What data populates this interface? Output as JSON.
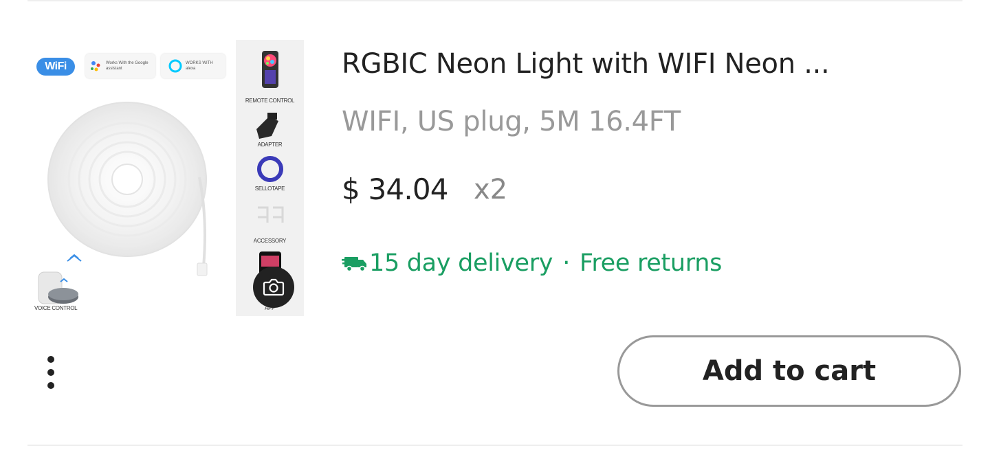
{
  "product": {
    "title": "RGBIC Neon Light with WIFI Neon ...",
    "variant": "WIFI, US plug, 5M 16.4FT",
    "price": "$ 34.04",
    "quantity": "x2",
    "delivery": "15 day delivery",
    "separator": "·",
    "returns": "Free returns",
    "accent_color": "#1a9e62"
  },
  "image": {
    "wifi_badge": "WiFi",
    "google_badge": "Works With the Google assistant",
    "alexa_badge": "WORKS WITH alexa",
    "voice_label": "VOICE CONTROL",
    "strip_labels": [
      "REMOTE CONTROL",
      "ADAPTER",
      "SELLOTAPE",
      "ACCESSORY",
      "APP"
    ]
  },
  "actions": {
    "add_to_cart_label": "Add to cart"
  },
  "icons": {
    "camera": "camera-icon",
    "truck": "truck-icon",
    "more": "more-vertical-icon"
  }
}
